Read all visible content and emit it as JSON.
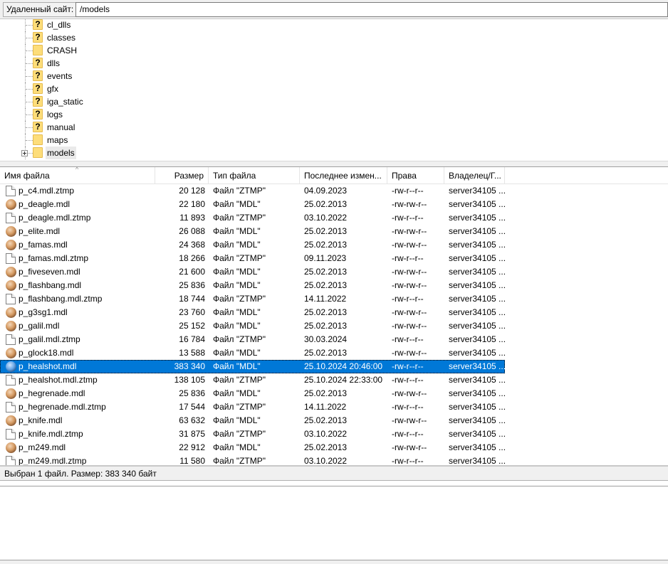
{
  "path_bar": {
    "label": "Удаленный сайт:",
    "value": "/models"
  },
  "tree": {
    "items": [
      {
        "label": "cl_dlls",
        "unknown": true
      },
      {
        "label": "classes",
        "unknown": true
      },
      {
        "label": "CRASH",
        "unknown": false
      },
      {
        "label": "dlls",
        "unknown": true
      },
      {
        "label": "events",
        "unknown": true
      },
      {
        "label": "gfx",
        "unknown": true
      },
      {
        "label": "iga_static",
        "unknown": true
      },
      {
        "label": "logs",
        "unknown": true
      },
      {
        "label": "manual",
        "unknown": true
      },
      {
        "label": "maps",
        "unknown": false
      },
      {
        "label": "models",
        "unknown": false,
        "expandable": true,
        "selected": true
      }
    ]
  },
  "columns": {
    "name": "Имя файла",
    "size": "Размер",
    "type": "Тип файла",
    "modified": "Последнее измен...",
    "perms": "Права",
    "owner": "Владелец/Г..."
  },
  "files": [
    {
      "name": "p_c4.mdl.ztmp",
      "size": "20 128",
      "type": "Файл \"ZTMP\"",
      "date": "04.09.2023",
      "perms": "-rw-r--r--",
      "owner": "server34105 ...",
      "icon": "document-icon"
    },
    {
      "name": "p_deagle.mdl",
      "size": "22 180",
      "type": "Файл \"MDL\"",
      "date": "25.02.2013",
      "perms": "-rw-rw-r--",
      "owner": "server34105 ...",
      "icon": "model-icon"
    },
    {
      "name": "p_deagle.mdl.ztmp",
      "size": "11 893",
      "type": "Файл \"ZTMP\"",
      "date": "03.10.2022",
      "perms": "-rw-r--r--",
      "owner": "server34105 ...",
      "icon": "document-icon"
    },
    {
      "name": "p_elite.mdl",
      "size": "26 088",
      "type": "Файл \"MDL\"",
      "date": "25.02.2013",
      "perms": "-rw-rw-r--",
      "owner": "server34105 ...",
      "icon": "model-icon"
    },
    {
      "name": "p_famas.mdl",
      "size": "24 368",
      "type": "Файл \"MDL\"",
      "date": "25.02.2013",
      "perms": "-rw-rw-r--",
      "owner": "server34105 ...",
      "icon": "model-icon"
    },
    {
      "name": "p_famas.mdl.ztmp",
      "size": "18 266",
      "type": "Файл \"ZTMP\"",
      "date": "09.11.2023",
      "perms": "-rw-r--r--",
      "owner": "server34105 ...",
      "icon": "document-icon"
    },
    {
      "name": "p_fiveseven.mdl",
      "size": "21 600",
      "type": "Файл \"MDL\"",
      "date": "25.02.2013",
      "perms": "-rw-rw-r--",
      "owner": "server34105 ...",
      "icon": "model-icon"
    },
    {
      "name": "p_flashbang.mdl",
      "size": "25 836",
      "type": "Файл \"MDL\"",
      "date": "25.02.2013",
      "perms": "-rw-rw-r--",
      "owner": "server34105 ...",
      "icon": "model-icon"
    },
    {
      "name": "p_flashbang.mdl.ztmp",
      "size": "18 744",
      "type": "Файл \"ZTMP\"",
      "date": "14.11.2022",
      "perms": "-rw-r--r--",
      "owner": "server34105 ...",
      "icon": "document-icon"
    },
    {
      "name": "p_g3sg1.mdl",
      "size": "23 760",
      "type": "Файл \"MDL\"",
      "date": "25.02.2013",
      "perms": "-rw-rw-r--",
      "owner": "server34105 ...",
      "icon": "model-icon"
    },
    {
      "name": "p_galil.mdl",
      "size": "25 152",
      "type": "Файл \"MDL\"",
      "date": "25.02.2013",
      "perms": "-rw-rw-r--",
      "owner": "server34105 ...",
      "icon": "model-icon"
    },
    {
      "name": "p_galil.mdl.ztmp",
      "size": "16 784",
      "type": "Файл \"ZTMP\"",
      "date": "30.03.2024",
      "perms": "-rw-r--r--",
      "owner": "server34105 ...",
      "icon": "document-icon"
    },
    {
      "name": "p_glock18.mdl",
      "size": "13 588",
      "type": "Файл \"MDL\"",
      "date": "25.02.2013",
      "perms": "-rw-rw-r--",
      "owner": "server34105 ...",
      "icon": "model-icon"
    },
    {
      "name": "p_healshot.mdl",
      "size": "383 340",
      "type": "Файл \"MDL\"",
      "date": "25.10.2024 20:46:00",
      "perms": "-rw-r--r--",
      "owner": "server34105 ...",
      "icon": "model-icon",
      "selected": true
    },
    {
      "name": "p_healshot.mdl.ztmp",
      "size": "138 105",
      "type": "Файл \"ZTMP\"",
      "date": "25.10.2024 22:33:00",
      "perms": "-rw-r--r--",
      "owner": "server34105 ...",
      "icon": "document-icon"
    },
    {
      "name": "p_hegrenade.mdl",
      "size": "25 836",
      "type": "Файл \"MDL\"",
      "date": "25.02.2013",
      "perms": "-rw-rw-r--",
      "owner": "server34105 ...",
      "icon": "model-icon"
    },
    {
      "name": "p_hegrenade.mdl.ztmp",
      "size": "17 544",
      "type": "Файл \"ZTMP\"",
      "date": "14.11.2022",
      "perms": "-rw-r--r--",
      "owner": "server34105 ...",
      "icon": "document-icon"
    },
    {
      "name": "p_knife.mdl",
      "size": "63 632",
      "type": "Файл \"MDL\"",
      "date": "25.02.2013",
      "perms": "-rw-rw-r--",
      "owner": "server34105 ...",
      "icon": "model-icon"
    },
    {
      "name": "p_knife.mdl.ztmp",
      "size": "31 875",
      "type": "Файл \"ZTMP\"",
      "date": "03.10.2022",
      "perms": "-rw-r--r--",
      "owner": "server34105 ...",
      "icon": "document-icon"
    },
    {
      "name": "p_m249.mdl",
      "size": "22 912",
      "type": "Файл \"MDL\"",
      "date": "25.02.2013",
      "perms": "-rw-rw-r--",
      "owner": "server34105 ...",
      "icon": "model-icon"
    },
    {
      "name": "p_m249.mdl.ztmp",
      "size": "11 580",
      "type": "Файл \"ZTMP\"",
      "date": "03.10.2022",
      "perms": "-rw-r--r--",
      "owner": "server34105 ...",
      "icon": "document-icon"
    }
  ],
  "status": {
    "text": "Выбран 1 файл. Размер: 383 340 байт"
  }
}
